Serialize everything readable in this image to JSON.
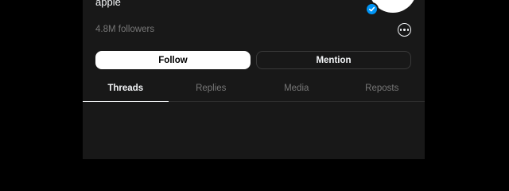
{
  "profile": {
    "username": "apple",
    "followers": "4.8M followers"
  },
  "actions": {
    "follow_label": "Follow",
    "mention_label": "Mention"
  },
  "tabs": [
    {
      "label": "Threads",
      "active": true
    },
    {
      "label": "Replies",
      "active": false
    },
    {
      "label": "Media",
      "active": false
    },
    {
      "label": "Reposts",
      "active": false
    }
  ],
  "icons": {
    "verified": "verified-badge-icon",
    "more": "more-options-icon"
  },
  "colors": {
    "background": "#000000",
    "panel": "#181818",
    "text_primary": "#f3f5f7",
    "text_secondary": "#777777",
    "verified": "#0095f6",
    "follow_button": "#ffffff"
  }
}
